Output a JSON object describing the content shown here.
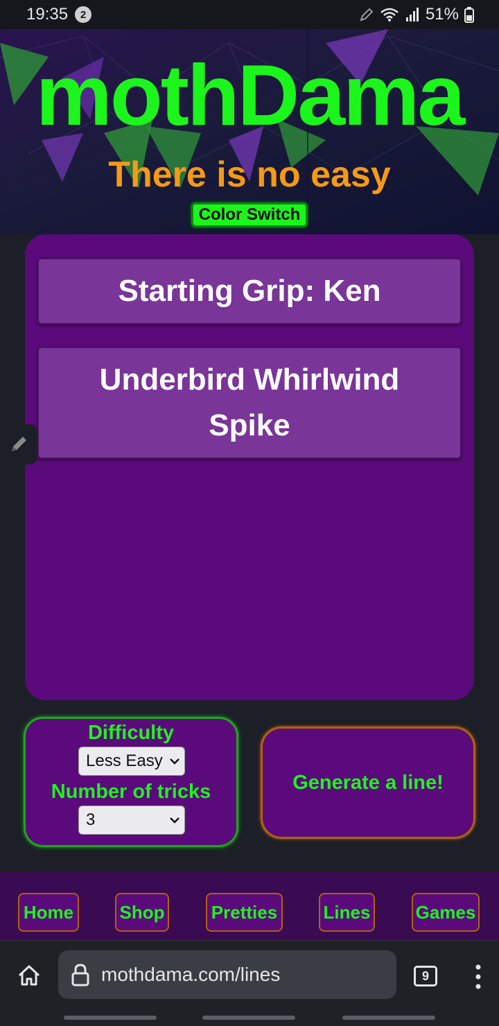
{
  "status_bar": {
    "time": "19:35",
    "notification_count": "2",
    "battery": "51%"
  },
  "hero": {
    "title": "mothDama",
    "tagline": "There is no easy",
    "color_switch_label": "Color Switch"
  },
  "tricks": {
    "starting_grip": "Starting Grip: Ken",
    "line": "Underbird Whirlwind Spike"
  },
  "controls": {
    "difficulty_label": "Difficulty",
    "difficulty_value": "Less Easy",
    "tricks_label": "Number of tricks",
    "tricks_value": "3"
  },
  "generate_button": "Generate a line!",
  "nav": {
    "items": [
      {
        "label": "Home"
      },
      {
        "label": "Shop"
      },
      {
        "label": "Pretties"
      },
      {
        "label": "Lines"
      },
      {
        "label": "Games"
      }
    ]
  },
  "browser": {
    "url": "mothdama.com/lines",
    "tab_count": "9"
  },
  "colors": {
    "neon_green": "#1cf51c",
    "orange": "#f59a16",
    "purple": "#5b0a7b",
    "card_purple": "#7a3598",
    "page_bg": "#1d1f27"
  }
}
